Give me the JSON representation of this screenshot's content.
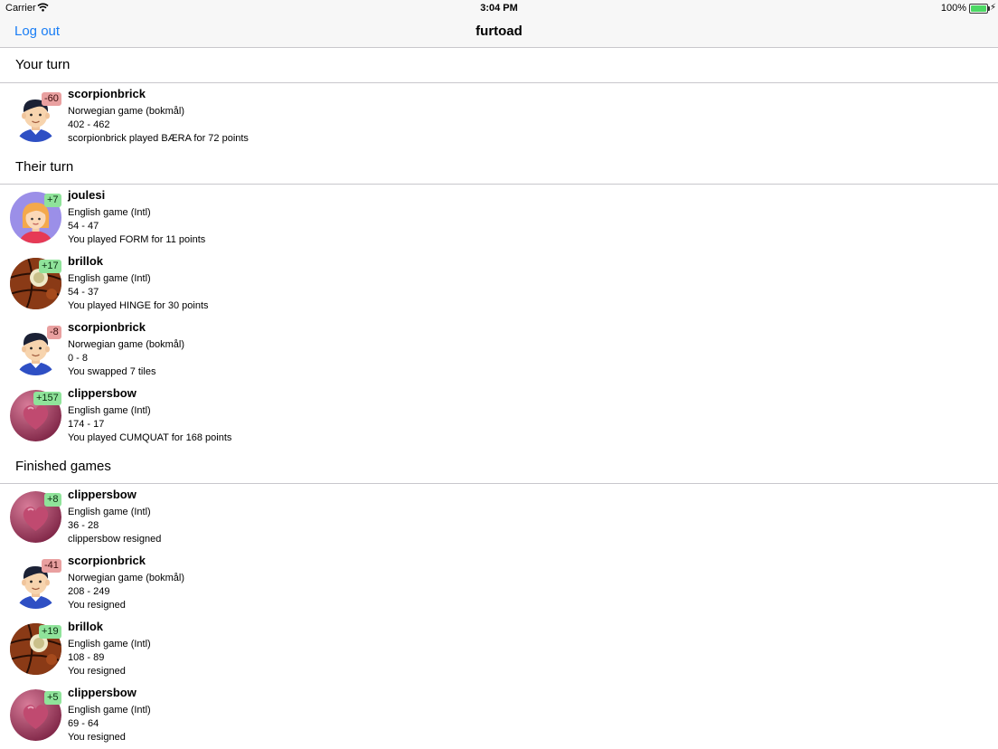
{
  "status_bar": {
    "carrier": "Carrier",
    "time": "3:04 PM",
    "battery": "100%"
  },
  "nav": {
    "logout": "Log out",
    "title": "furtoad"
  },
  "sections": {
    "your_turn": {
      "title": "Your turn",
      "games": [
        {
          "player": "scorpionbrick",
          "avatar": "boy",
          "diff": "-60",
          "sign": "neg",
          "game": "Norwegian game (bokmål)",
          "score": "402 - 462",
          "last": "scorpionbrick played BÆRA for 72 points"
        }
      ]
    },
    "their_turn": {
      "title": "Their turn",
      "games": [
        {
          "player": "joulesi",
          "avatar": "girl",
          "diff": "+7",
          "sign": "pos",
          "game": "English game (Intl)",
          "score": "54 - 47",
          "last": "You played FORM for 11 points"
        },
        {
          "player": "brillok",
          "avatar": "basketball",
          "diff": "+17",
          "sign": "pos",
          "game": "English game (Intl)",
          "score": "54 - 37",
          "last": "You played HINGE for 30 points"
        },
        {
          "player": "scorpionbrick",
          "avatar": "boy",
          "diff": "-8",
          "sign": "neg",
          "game": "Norwegian game (bokmål)",
          "score": "0 - 8",
          "last": "You swapped 7 tiles"
        },
        {
          "player": "clippersbow",
          "avatar": "heart",
          "diff": "+157",
          "sign": "pos",
          "game": "English game (Intl)",
          "score": "174 - 17",
          "last": "You played CUMQUAT for 168 points"
        }
      ]
    },
    "finished": {
      "title": "Finished games",
      "games": [
        {
          "player": "clippersbow",
          "avatar": "heart",
          "diff": "+8",
          "sign": "pos",
          "game": "English game (Intl)",
          "score": "36 - 28",
          "last": "clippersbow resigned"
        },
        {
          "player": "scorpionbrick",
          "avatar": "boy",
          "diff": "-41",
          "sign": "neg",
          "game": "Norwegian game (bokmål)",
          "score": "208 - 249",
          "last": "You resigned"
        },
        {
          "player": "brillok",
          "avatar": "basketball",
          "diff": "+19",
          "sign": "pos",
          "game": "English game (Intl)",
          "score": "108 - 89",
          "last": "You resigned"
        },
        {
          "player": "clippersbow",
          "avatar": "heart",
          "diff": "+5",
          "sign": "pos",
          "game": "English game (Intl)",
          "score": "69 - 64",
          "last": "You resigned"
        }
      ]
    }
  },
  "colors": {
    "link": "#1a7ef5",
    "badge_positive": "#8fe39a",
    "badge_negative": "#e9a0a0"
  }
}
